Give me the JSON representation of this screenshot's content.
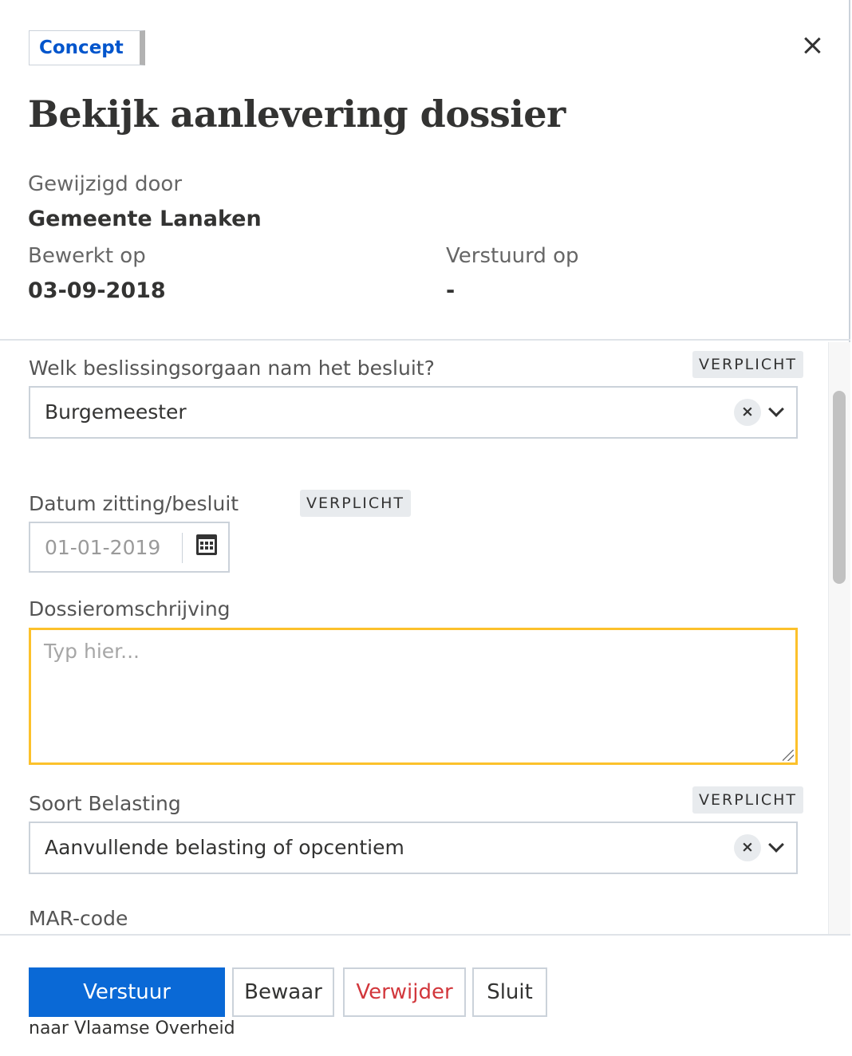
{
  "header": {
    "status_badge": "Concept",
    "title": "Bekijk aanlevering dossier",
    "modified_by_label": "Gewijzigd door",
    "modified_by_value": "Gemeente Lanaken",
    "edited_on_label": "Bewerkt op",
    "edited_on_value": "03-09-2018",
    "sent_on_label": "Verstuurd op",
    "sent_on_value": "-"
  },
  "form": {
    "required_tag": "VERPLICHT",
    "decision_body": {
      "label": "Welk beslissingsorgaan nam het besluit?",
      "value": "Burgemeester",
      "clear_symbol": "×"
    },
    "decision_date": {
      "label": "Datum zitting/besluit",
      "placeholder": "01-01-2019"
    },
    "description": {
      "label": "Dossieromschrijving",
      "placeholder": "Typ hier..."
    },
    "tax_type": {
      "label": "Soort Belasting",
      "value": "Aanvullende belasting of opcentiem",
      "clear_symbol": "×"
    },
    "mar_code": {
      "label": "MAR-code"
    }
  },
  "footer": {
    "send_label": "Verstuur",
    "save_label": "Bewaar",
    "delete_label": "Verwijder",
    "close_label": "Sluit",
    "send_note": "naar Vlaamse Overheid"
  },
  "colors": {
    "primary": "#0a69d6",
    "danger": "#d2373c",
    "focus_border": "#fcc12b",
    "badge_text": "#0055cc"
  },
  "icons": [
    "close-icon",
    "calendar-icon",
    "clear-icon",
    "chevron-down-icon"
  ]
}
